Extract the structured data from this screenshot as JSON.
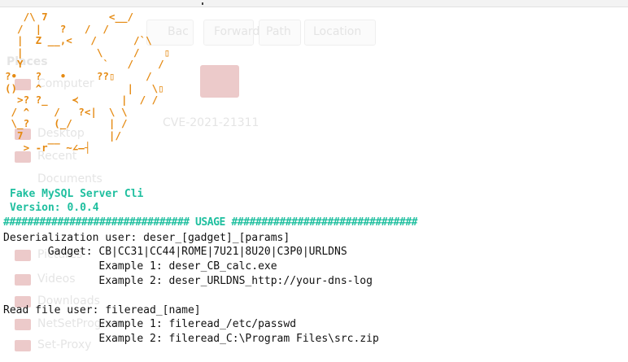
{
  "ascii_art": "   /\\ 7          <__/\n  /  |   ?   /  /\n  |  Z __,<   /      /`\\\n  |            \\     /    ▯\n  Y             `   /    /\n?•   ?   •     ??▯     /\n()   ^              |   \\▯\n  >? ?_    ≺       |  / /\n / ^    /   ?<|  \\ \\\n \\_?    (_/      | /\n  7              |/\n   > -r‾‾ ~∠—┤",
  "app": {
    "name": "Fake MySQL Server Cli",
    "version": "Version: 0.0.4"
  },
  "usage_bar": "############################### USAGE ###############################",
  "usage": {
    "deser_label": "Deserialization user: deser_[gadget]_[params]",
    "gadget_line": "       Gadget: CB|CC31|CC44|ROME|7U21|8U20|C3P0|URLDNS",
    "deser_ex1": "               Example 1: deser_CB_calc.exe",
    "deser_ex2": "               Example 2: deser_URLDNS_http://your-dns-log",
    "read_label": "Read file user: fileread_[name]",
    "read_ex1": "               Example 1: fileread_/etc/passwd",
    "read_ex2": "               Example 2: fileread_C:\\Program Files\\src.zip"
  },
  "background_ui": {
    "tabs": [
      "Bac",
      "Forward",
      "Path",
      "Location"
    ],
    "places_heading": "Places",
    "places": [
      "Computer",
      "Desktop",
      "Recent",
      "Documents",
      "Pictures",
      "Videos",
      "Downloads",
      "NetSetProgram",
      "Set-Proxy"
    ],
    "folder_name": "CVE-2021-21311"
  },
  "colors": {
    "ascii": "#e58a12",
    "teal": "#1fbf9f",
    "text": "#111111"
  }
}
